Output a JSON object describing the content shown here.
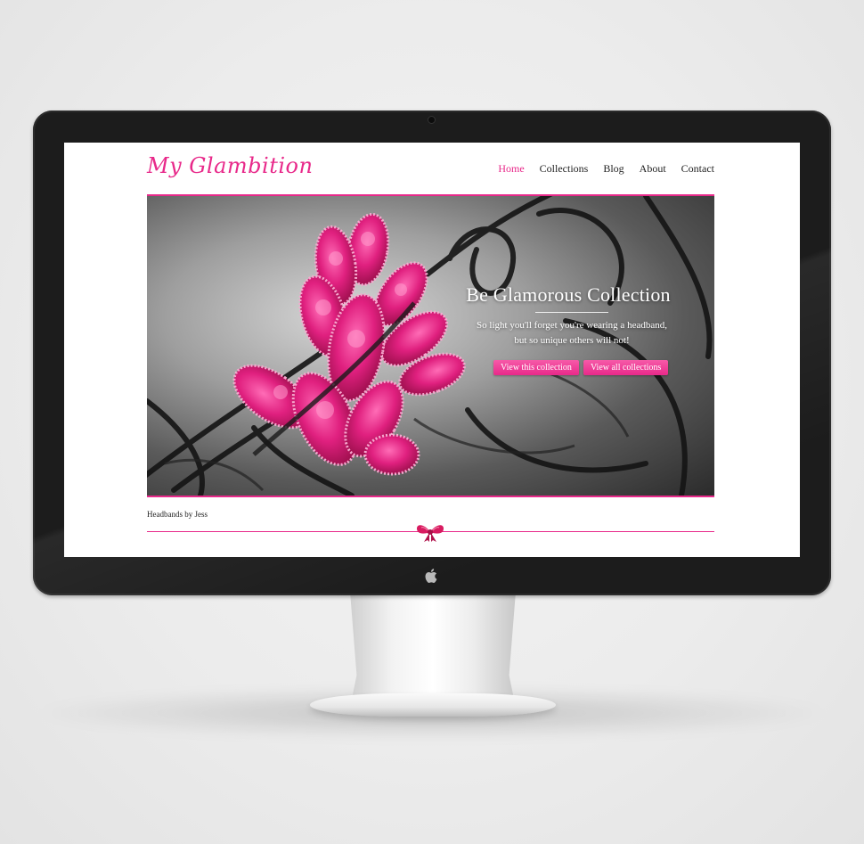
{
  "site": {
    "logo": "My Glambition",
    "nav": [
      {
        "label": "Home",
        "active": true
      },
      {
        "label": "Collections",
        "active": false
      },
      {
        "label": "Blog",
        "active": false
      },
      {
        "label": "About",
        "active": false
      },
      {
        "label": "Contact",
        "active": false
      }
    ]
  },
  "hero": {
    "title": "Be Glamorous Collection",
    "subtitle_line1": "So light you'll forget you're wearing a headband,",
    "subtitle_line2": "but so unique others will not!",
    "primary_button": "View this collection",
    "secondary_button": "View all collections"
  },
  "footer": {
    "text": "Headbands by Jess"
  },
  "colors": {
    "accent": "#e8298a",
    "monitor_bezel": "#1c1c1c",
    "page_background": "#ececec"
  },
  "icons": {
    "device_logo": "apple-logo-icon",
    "footer_ornament": "bow-icon"
  }
}
